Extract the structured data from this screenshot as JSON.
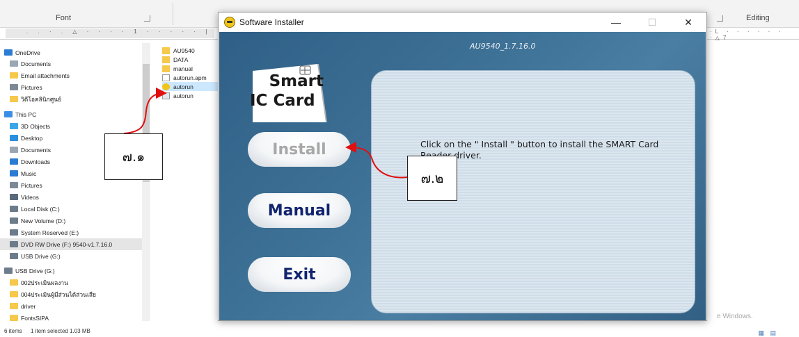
{
  "ribbon": {
    "font_label": "Font",
    "editing_label": "Editing",
    "ruler_left": ". . · . △ · · · · 1 · · · · · |",
    "ruler_right": "·L · · · · · · ·△7"
  },
  "nav": {
    "items": [
      {
        "label": "OneDrive",
        "icon": "cloud-icon",
        "color": "#2b7cd3"
      },
      {
        "label": "Documents",
        "icon": "document-icon",
        "color": "#9aa6b2"
      },
      {
        "label": "Email attachments",
        "icon": "folder-icon",
        "color": "#f6c84b"
      },
      {
        "label": "Pictures",
        "icon": "pictures-icon",
        "color": "#7d8a96"
      },
      {
        "label": "วิดีโอคลินิกศูนย์",
        "icon": "folder-icon",
        "color": "#f6c84b"
      },
      {
        "label": "This PC",
        "icon": "computer-icon",
        "color": "#3a8ee6"
      },
      {
        "label": "3D Objects",
        "icon": "cube-icon",
        "color": "#3aa6e8"
      },
      {
        "label": "Desktop",
        "icon": "desktop-icon",
        "color": "#2b8fe0"
      },
      {
        "label": "Documents",
        "icon": "document-icon",
        "color": "#9aa6b2"
      },
      {
        "label": "Downloads",
        "icon": "download-icon",
        "color": "#2b7cd3"
      },
      {
        "label": "Music",
        "icon": "music-icon",
        "color": "#2b7cd3"
      },
      {
        "label": "Pictures",
        "icon": "pictures-icon",
        "color": "#7d8a96"
      },
      {
        "label": "Videos",
        "icon": "video-icon",
        "color": "#5a6a7a"
      },
      {
        "label": "Local Disk (C:)",
        "icon": "drive-icon",
        "color": "#6d7c8b"
      },
      {
        "label": "New Volume (D:)",
        "icon": "drive-icon",
        "color": "#6d7c8b"
      },
      {
        "label": "System Reserved (E:)",
        "icon": "drive-icon",
        "color": "#6d7c8b"
      },
      {
        "label": "DVD RW Drive (F:) 9540-v1.7.16.0",
        "icon": "disc-icon",
        "color": "#6d7c8b",
        "selected": true
      },
      {
        "label": "USB Drive (G:)",
        "icon": "usb-drive-icon",
        "color": "#6d7c8b"
      },
      {
        "label": "USB Drive (G:)",
        "icon": "usb-drive-icon",
        "color": "#6d7c8b"
      },
      {
        "label": "002ประเมินผลงาน",
        "icon": "folder-icon",
        "color": "#f6c84b"
      },
      {
        "label": "004ประเมินผู้มีส่วนได้ส่วนเสีย",
        "icon": "folder-icon",
        "color": "#f6c84b"
      },
      {
        "label": "driver",
        "icon": "folder-icon",
        "color": "#f6c84b"
      },
      {
        "label": "FontsSIPA",
        "icon": "folder-icon",
        "color": "#f6c84b"
      }
    ]
  },
  "files": [
    {
      "label": "AU9540",
      "icon": "folder-icon"
    },
    {
      "label": "DATA",
      "icon": "folder-icon"
    },
    {
      "label": "manual",
      "icon": "folder-icon"
    },
    {
      "label": "autorun.apm",
      "icon": "file-icon"
    },
    {
      "label": "autorun",
      "icon": "autorun-icon",
      "selected": true
    },
    {
      "label": "autorun",
      "icon": "setup-info-icon"
    }
  ],
  "status": {
    "items": "6 items",
    "selection": "1 item selected  1.03 MB"
  },
  "watermark": "e Windows.",
  "installer": {
    "title": "Software Installer",
    "version": "AU9540_1.7.16.0",
    "logo_line1": "Smart",
    "logo_line2": "IC Card",
    "install_label": "Install",
    "manual_label": "Manual",
    "exit_label": "Exit",
    "message": "Click on the \" Install \" button to install the SMART Card Reader driver.",
    "colors": {
      "button_text": "#12246e",
      "disabled_text": "#a8a8a8",
      "background": "#3f7297"
    }
  },
  "annotations": {
    "step1": "๗.๑",
    "step2": "๗.๒",
    "arrow_color": "#e01010"
  }
}
